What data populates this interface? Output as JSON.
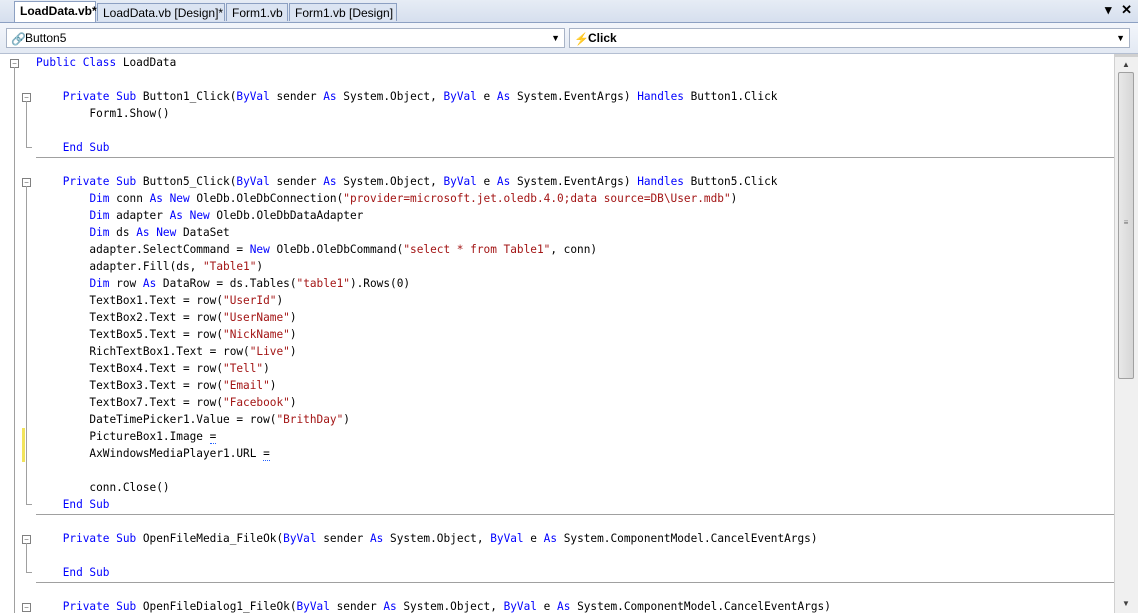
{
  "tabs": [
    {
      "label": "LoadData.vb*",
      "active": true
    },
    {
      "label": "LoadData.vb [Design]*",
      "active": false
    },
    {
      "label": "Form1.vb",
      "active": false
    },
    {
      "label": "Form1.vb [Design]",
      "active": false
    }
  ],
  "tab_controls": {
    "dropdown": "▾",
    "close": "✕"
  },
  "navigation": {
    "object_combo": {
      "value": "Button5",
      "icon": "control-icon"
    },
    "method_combo": {
      "value": "Click",
      "icon": "lightning-event-icon"
    }
  },
  "code_lines": [
    [
      {
        "t": "Public Class ",
        "c": "kw"
      },
      {
        "t": "LoadData"
      }
    ],
    [],
    [
      {
        "t": "    "
      },
      {
        "t": "Private Sub ",
        "c": "kw"
      },
      {
        "t": "Button1_Click("
      },
      {
        "t": "ByVal",
        "c": "kw"
      },
      {
        "t": " sender "
      },
      {
        "t": "As",
        "c": "kw"
      },
      {
        "t": " System.Object, "
      },
      {
        "t": "ByVal",
        "c": "kw"
      },
      {
        "t": " e "
      },
      {
        "t": "As",
        "c": "kw"
      },
      {
        "t": " System.EventArgs) "
      },
      {
        "t": "Handles",
        "c": "kw"
      },
      {
        "t": " Button1.Click"
      }
    ],
    [
      {
        "t": "        Form1.Show()"
      }
    ],
    [],
    [
      {
        "t": "    "
      },
      {
        "t": "End Sub",
        "c": "kw"
      }
    ],
    [],
    [
      {
        "t": "    "
      },
      {
        "t": "Private Sub ",
        "c": "kw"
      },
      {
        "t": "Button5_Click("
      },
      {
        "t": "ByVal",
        "c": "kw"
      },
      {
        "t": " sender "
      },
      {
        "t": "As",
        "c": "kw"
      },
      {
        "t": " System.Object, "
      },
      {
        "t": "ByVal",
        "c": "kw"
      },
      {
        "t": " e "
      },
      {
        "t": "As",
        "c": "kw"
      },
      {
        "t": " System.EventArgs) "
      },
      {
        "t": "Handles",
        "c": "kw"
      },
      {
        "t": " Button5.Click"
      }
    ],
    [
      {
        "t": "        "
      },
      {
        "t": "Dim",
        "c": "kw"
      },
      {
        "t": " conn "
      },
      {
        "t": "As New",
        "c": "kw"
      },
      {
        "t": " OleDb.OleDbConnection("
      },
      {
        "t": "\"provider=microsoft.jet.oledb.4.0;data source=DB\\User.mdb\"",
        "c": "str"
      },
      {
        "t": ")"
      }
    ],
    [
      {
        "t": "        "
      },
      {
        "t": "Dim",
        "c": "kw"
      },
      {
        "t": " adapter "
      },
      {
        "t": "As New",
        "c": "kw"
      },
      {
        "t": " OleDb.OleDbDataAdapter"
      }
    ],
    [
      {
        "t": "        "
      },
      {
        "t": "Dim",
        "c": "kw"
      },
      {
        "t": " ds "
      },
      {
        "t": "As New",
        "c": "kw"
      },
      {
        "t": " DataSet"
      }
    ],
    [
      {
        "t": "        adapter.SelectCommand = "
      },
      {
        "t": "New",
        "c": "kw"
      },
      {
        "t": " OleDb.OleDbCommand("
      },
      {
        "t": "\"select * from Table1\"",
        "c": "str"
      },
      {
        "t": ", conn)"
      }
    ],
    [
      {
        "t": "        adapter.Fill(ds, "
      },
      {
        "t": "\"Table1\"",
        "c": "str"
      },
      {
        "t": ")"
      }
    ],
    [
      {
        "t": "        "
      },
      {
        "t": "Dim",
        "c": "kw"
      },
      {
        "t": " row "
      },
      {
        "t": "As",
        "c": "kw"
      },
      {
        "t": " DataRow = ds.Tables("
      },
      {
        "t": "\"table1\"",
        "c": "str"
      },
      {
        "t": ").Rows(0)"
      }
    ],
    [
      {
        "t": "        TextBox1.Text = row("
      },
      {
        "t": "\"UserId\"",
        "c": "str"
      },
      {
        "t": ")"
      }
    ],
    [
      {
        "t": "        TextBox2.Text = row("
      },
      {
        "t": "\"UserName\"",
        "c": "str"
      },
      {
        "t": ")"
      }
    ],
    [
      {
        "t": "        TextBox5.Text = row("
      },
      {
        "t": "\"NickName\"",
        "c": "str"
      },
      {
        "t": ")"
      }
    ],
    [
      {
        "t": "        RichTextBox1.Text = row("
      },
      {
        "t": "\"Live\"",
        "c": "str"
      },
      {
        "t": ")"
      }
    ],
    [
      {
        "t": "        TextBox4.Text = row("
      },
      {
        "t": "\"Tell\"",
        "c": "str"
      },
      {
        "t": ")"
      }
    ],
    [
      {
        "t": "        TextBox3.Text = row("
      },
      {
        "t": "\"Email\"",
        "c": "str"
      },
      {
        "t": ")"
      }
    ],
    [
      {
        "t": "        TextBox7.Text = row("
      },
      {
        "t": "\"Facebook\"",
        "c": "str"
      },
      {
        "t": ")"
      }
    ],
    [
      {
        "t": "        DateTimePicker1.Value = row("
      },
      {
        "t": "\"BrithDay\"",
        "c": "str"
      },
      {
        "t": ")"
      }
    ],
    [
      {
        "t": "        PictureBox1.Image "
      },
      {
        "t": "=",
        "c": "squig"
      }
    ],
    [
      {
        "t": "        AxWindowsMediaPlayer1.URL "
      },
      {
        "t": "=",
        "c": "squig"
      }
    ],
    [],
    [
      {
        "t": "        conn.Close()"
      }
    ],
    [
      {
        "t": "    "
      },
      {
        "t": "End Sub",
        "c": "kw"
      }
    ],
    [],
    [
      {
        "t": "    "
      },
      {
        "t": "Private Sub ",
        "c": "kw"
      },
      {
        "t": "OpenFileMedia_FileOk("
      },
      {
        "t": "ByVal",
        "c": "kw"
      },
      {
        "t": " sender "
      },
      {
        "t": "As",
        "c": "kw"
      },
      {
        "t": " System.Object, "
      },
      {
        "t": "ByVal",
        "c": "kw"
      },
      {
        "t": " e "
      },
      {
        "t": "As",
        "c": "kw"
      },
      {
        "t": " System.ComponentModel.CancelEventArgs)"
      }
    ],
    [],
    [
      {
        "t": "    "
      },
      {
        "t": "End Sub",
        "c": "kw"
      }
    ],
    [],
    [
      {
        "t": "    "
      },
      {
        "t": "Private Sub ",
        "c": "kw"
      },
      {
        "t": "OpenFileDialog1_FileOk("
      },
      {
        "t": "ByVal",
        "c": "kw"
      },
      {
        "t": " sender "
      },
      {
        "t": "As",
        "c": "kw"
      },
      {
        "t": " System.Object, "
      },
      {
        "t": "ByVal",
        "c": "kw"
      },
      {
        "t": " e "
      },
      {
        "t": "As",
        "c": "kw"
      },
      {
        "t": " System.ComponentModel.CancelEventArgs)"
      }
    ]
  ],
  "colors": {
    "keyword": "#0000ff",
    "string": "#a31515",
    "text": "#000000",
    "changed_marker": "#f2e45c"
  }
}
